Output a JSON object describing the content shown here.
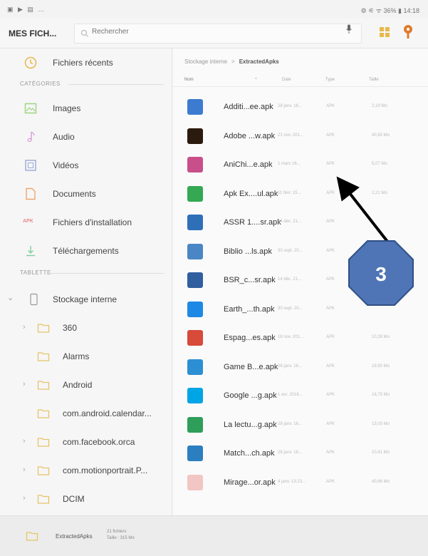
{
  "status_bar": {
    "left": "▣ ▶ ▤ …",
    "right": "⚙ ⚟ ᯤ 36% ▮ 14:18"
  },
  "header": {
    "title": "MES FICH...",
    "search_placeholder": "Rechercher"
  },
  "sidebar": {
    "recent": "Fichiers récents",
    "categories_header": "CATÉGORIES",
    "categories": [
      {
        "label": "Images",
        "icon": "image-icon"
      },
      {
        "label": "Audio",
        "icon": "music-note-icon"
      },
      {
        "label": "Vidéos",
        "icon": "video-icon"
      },
      {
        "label": "Documents",
        "icon": "document-icon"
      },
      {
        "label": "Fichiers d'installation",
        "icon": "apk-icon",
        "icon_text": "APK"
      },
      {
        "label": "Téléchargements",
        "icon": "download-icon"
      }
    ],
    "tablet_header": "TABLETTE",
    "storage": "Stockage interne",
    "folders": [
      {
        "label": "360",
        "expandable": true
      },
      {
        "label": "Alarms",
        "expandable": false
      },
      {
        "label": "Android",
        "expandable": true
      },
      {
        "label": "com.android.calendar...",
        "expandable": false
      },
      {
        "label": "com.facebook.orca",
        "expandable": true
      },
      {
        "label": "com.motionportrait.P...",
        "expandable": true
      },
      {
        "label": "DCIM",
        "expandable": true
      }
    ]
  },
  "breadcrumb": {
    "root": "Stockage interne",
    "separator": ">",
    "current": "ExtractedApks"
  },
  "columns": {
    "name": "Nom",
    "date": "Date",
    "type": "Type",
    "size": "Taille"
  },
  "files": [
    {
      "name": "Additi...ee.apk",
      "date": "28 janv. 16...",
      "type": "APK",
      "size": "2,19 Mo",
      "color": "#3c7bd0"
    },
    {
      "name": "Adobe ...w.apk",
      "date": "21 nov. 201...",
      "type": "APK",
      "size": "40,93 Mo",
      "color": "#2b1a0e"
    },
    {
      "name": "AniChi...e.apk",
      "date": "1 mars 16...",
      "type": "APK",
      "size": "5,07 Mo",
      "color": "#c94f8a"
    },
    {
      "name": "Apk Ex....ul.apk",
      "date": "11 févr. 15...",
      "type": "APK",
      "size": "2,21 Mo",
      "color": "#34a853"
    },
    {
      "name": "ASSR 1....sr.apk",
      "date": "14 déc. 21...",
      "type": "APK",
      "size": "",
      "color": "#2f6fb8"
    },
    {
      "name": "Biblio ...ls.apk",
      "date": "30 sept. 20...",
      "type": "APK",
      "size": "",
      "color": "#4a86c5"
    },
    {
      "name": "BSR_c...sr.apk",
      "date": "14 déc. 21...",
      "type": "APK",
      "size": "",
      "color": "#2f5f9f"
    },
    {
      "name": "Earth_...th.apk",
      "date": "30 sept. 20...",
      "type": "APK",
      "size": "",
      "color": "#1e88e5"
    },
    {
      "name": "Espag...es.apk",
      "date": "18 nov. 201...",
      "type": "APK",
      "size": "10,28 Mo",
      "color": "#d84a3a"
    },
    {
      "name": "Game B...e.apk",
      "date": "28 janv. 16...",
      "type": "APK",
      "size": "19,93 Mo",
      "color": "#2d8fd3"
    },
    {
      "name": "Google ...g.apk",
      "date": "1 avr. 2016...",
      "type": "APK",
      "size": "16,75 Mo",
      "color": "#00a5e6"
    },
    {
      "name": "La lectu...g.apk",
      "date": "28 janv. 16...",
      "type": "APK",
      "size": "13,03 Mo",
      "color": "#2e9e5a"
    },
    {
      "name": "Match...ch.apk",
      "date": "28 janv. 16...",
      "type": "APK",
      "size": "10,41 Mo",
      "color": "#2b7fc0"
    },
    {
      "name": "Mirage...or.apk",
      "date": "4 janv. 13:23...",
      "type": "APK",
      "size": "40,66 Mo",
      "color": "#f2c6c2"
    }
  ],
  "bottom_bar": {
    "folder": "ExtractedApks",
    "count": "21 fichiers",
    "size": "Taille : 315 Mo"
  },
  "annotation": {
    "number": "3"
  }
}
